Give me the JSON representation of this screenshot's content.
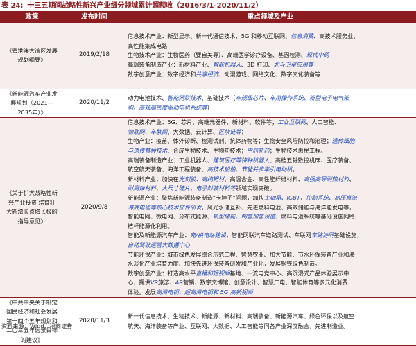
{
  "title": {
    "label": "表 24:",
    "text": "十三五期间战略性新兴产业细分领域累计超额收（2016/3/1-2020/11/2）"
  },
  "table": {
    "headers": [
      "政策",
      "发布时间",
      "重点领域及产业"
    ],
    "rows": [
      {
        "policy": "《粤港澳大湾区发展规划纲要》",
        "date": "2019/2/18",
        "lines": [
          [
            {
              "t": "信息技术产业：新型显示、新一代通信技术、5G 和移动互联网、"
            },
            {
              "t": "信息消费",
              "hl": true
            },
            {
              "t": "、高技术服务业、"
            }
          ],
          [
            {
              "t": "高性能集成电路"
            }
          ],
          [
            {
              "t": "生物技术产业：生物医药（要自美导）、高端医学诊疗设备、基因检测、"
            },
            {
              "t": "现代中药",
              "hl": true
            }
          ],
          [
            {
              "t": "高端装备制造产业：新材料产业、"
            },
            {
              "t": "智能机器人",
              "hl": true
            },
            {
              "t": "、3D 打印、"
            },
            {
              "t": "北斗卫星应用等",
              "hl": true
            }
          ],
          [
            {
              "t": "数字创意产业：数字经济和"
            },
            {
              "t": "共享经济",
              "hl": true
            },
            {
              "t": "、动漫游戏、网络文化、数字文化装备等"
            }
          ]
        ]
      },
      {
        "policy": "《新能源汽车产业发展规划（2021—2035年）》",
        "date": "2020/11/2",
        "lines": [
          [
            {
              "t": "动力电池技术、"
            },
            {
              "t": "智能网联技术",
              "hl": true
            },
            {
              "t": "、基础技术（"
            },
            {
              "t": "车规级芯片、车用操作系统、新型电子电气架",
              "hl": true
            }
          ],
          [
            {
              "t": "构、高效高密度驱动电机系统等",
              "hl": true
            },
            {
              "t": "）"
            }
          ]
        ]
      },
      {
        "policy": "《关于扩大战略性新兴产业投资 培育壮大新增长点增长极的指导意见》",
        "date": "2020/9/8",
        "lines": [
          [
            {
              "t": "信息技术产业：5G、芯片、高端元器件、新材料、软件等；"
            },
            {
              "t": "工业互联网",
              "hl": true
            },
            {
              "t": "、人工智能、"
            }
          ],
          [
            {
              "t": "物联网、车联网",
              "hl": true
            },
            {
              "t": "、大数据、云计算、"
            },
            {
              "t": "区块链等",
              "hl": true
            },
            {
              "t": "；"
            }
          ],
          [
            {
              "t": "生物产业：疫苗、体外诊断、检测试剂、抗体药物等；生物安全风险防控和治理；"
            },
            {
              "t": "遗传细胞",
              "hl": true
            }
          ],
          [
            {
              "t": "与遗传育种技术",
              "hl": true
            },
            {
              "t": "、合成生物技术、生物药技术；"
            },
            {
              "t": "中药新药",
              "hl": true
            },
            {
              "t": "；生物技术惠民工程。"
            }
          ],
          [
            {
              "t": "高端装备制造产业：工业机器人、"
            },
            {
              "t": "建筑医疗等特种机器人",
              "hl": true
            },
            {
              "t": "、高档五轴数控机床、医疗装备、"
            }
          ],
          [
            {
              "t": "航空航天装备、海洋工程装备、"
            },
            {
              "t": "高技术船舶、节能并步率引电动机",
              "hl": true
            },
            {
              "t": "。"
            }
          ],
          [
            {
              "t": "新材料产业：加快在"
            },
            {
              "t": "光刻胶、高纯靶材",
              "hl": true
            },
            {
              "t": "、高温合金、高性能纤维材料、"
            },
            {
              "t": "高强高导耐热材料",
              "hl": true
            },
            {
              "t": "、"
            }
          ],
          [
            {
              "t": "耐腐蚀材料、大尺寸硅片、电子封装材料等",
              "hl": true
            },
            {
              "t": "领域实现突破。"
            }
          ],
          [
            {
              "t": "新能源产业：聚焦新能源装备制造“卡脖子”问题，加快"
            },
            {
              "t": "主轴承、IGBT、控制系统、高压直流",
              "hl": true
            }
          ],
          [
            {
              "t": "海底电缆等核心技术部件研发",
              "hl": true
            },
            {
              "t": "。风光水储互补、先进燃料电池、高效储能与海洋能发电等，"
            }
          ],
          [
            {
              "t": "智能电网、微电网、分布式能源、"
            },
            {
              "t": "新型储能、制氢加氢设施",
              "hl": true
            },
            {
              "t": "、燃料电池系统等基础设施网络，"
            }
          ],
          [
            {
              "t": "桔杆能源化利用。"
            }
          ],
          [
            {
              "t": "智能及新能源汽车产业："
            },
            {
              "t": "充/换电站建设",
              "hl": true
            },
            {
              "t": "，智能网联汽车道路测试、车联网"
            },
            {
              "t": "车路协同",
              "hl": true
            },
            {
              "t": "基础设施，"
            }
          ],
          [
            {
              "t": "自动驾驶运营大数据中心",
              "hl": true
            }
          ],
          [
            {
              "t": "节能环保产业：城市绿色发展综合示范工程、智慧农业、加大节能、节水环保装备产业和海"
            }
          ],
          [
            {
              "t": "水淡化产业培育力度、加快先进环保装备研发和产业化，发展钢铁绿色制造。"
            }
          ],
          [
            {
              "t": "数字创意产业：打造高水平"
            },
            {
              "t": "直播和短视频",
              "hl": true
            },
            {
              "t": "基地、一流电竞中心、高沉浸式产品体验展示中"
            }
          ],
          [
            {
              "t": "心，提供"
            },
            {
              "t": "VR",
              "hl": true
            },
            {
              "t": "旅游、"
            },
            {
              "t": "AR",
              "hl": true
            },
            {
              "t": "营销、数字文博馆、创意设计、智慧广电、智能体育等多元化消费"
            }
          ],
          [
            {
              "t": "体验。发展"
            },
            {
              "t": "高清电视、超高清电视和 5G 高新视频",
              "hl": true
            }
          ]
        ]
      },
      {
        "policy": "《中共中央关于制定国民经济和社会发展第十四个五年规划和二〇三五年远景目标的建议》",
        "date": "2020/11/3",
        "lines": [
          [
            {
              "t": "新一代信息技术、生物技术、新能源、新材料、高端装备、新能源汽车、绿色环保以及航空"
            }
          ],
          [
            {
              "t": "航天、海洋装备等产业、互联网、大数据、人工智能等同各产业深度融合，先进制造业。"
            }
          ]
        ]
      }
    ]
  },
  "source": "资料来源：Wind，招商证券"
}
